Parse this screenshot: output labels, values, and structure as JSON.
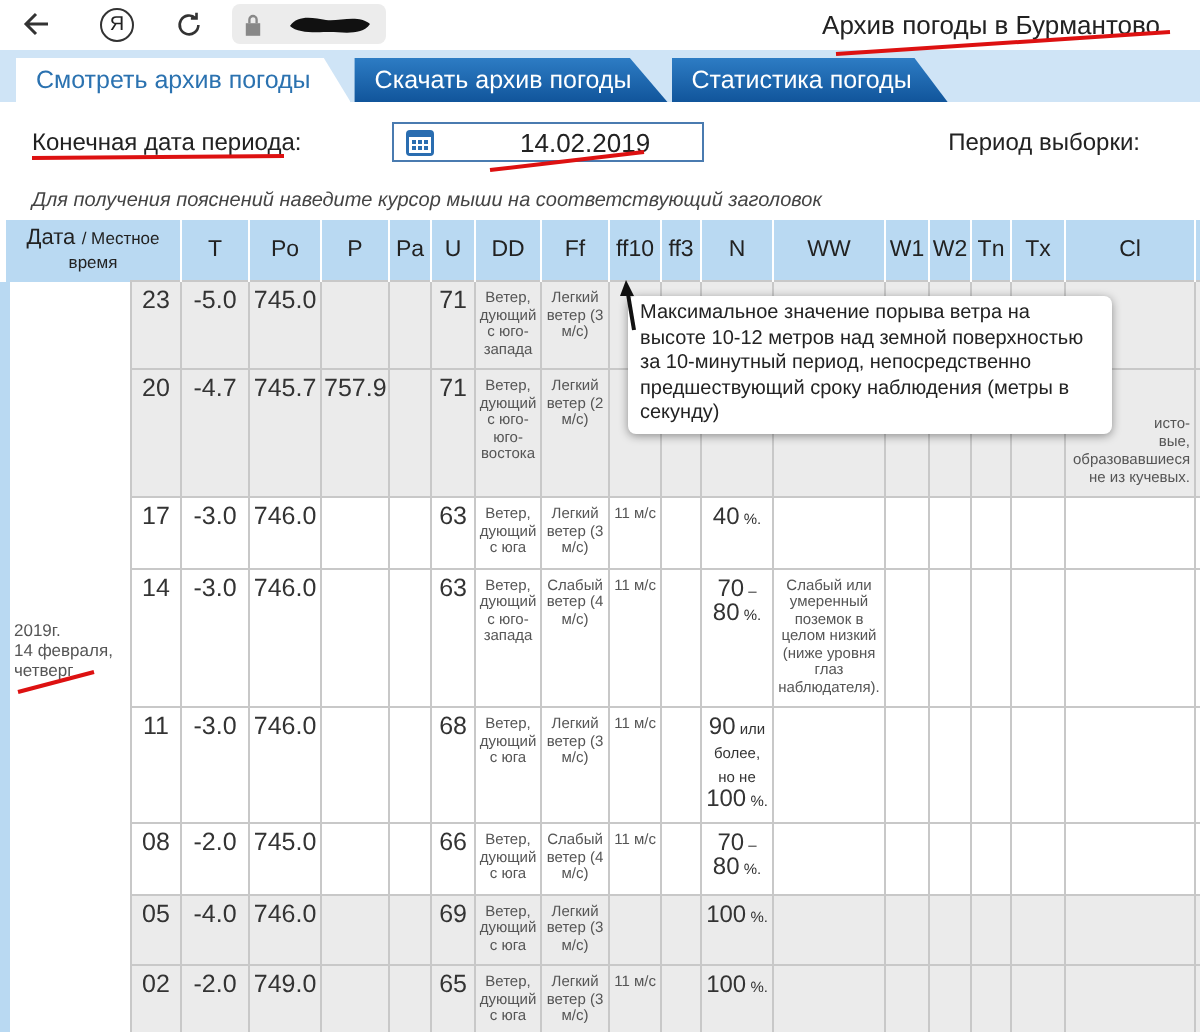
{
  "browser": {
    "yandex_button": "Я",
    "page_title": "Архив погоды в Бурмантово"
  },
  "tabs": [
    {
      "label": "Смотреть архив погоды",
      "selected": true
    },
    {
      "label": "Скачать архив погоды",
      "selected": false
    },
    {
      "label": "Статистика погоды",
      "selected": false
    }
  ],
  "controls": {
    "end_date_label": "Конечная дата периода:",
    "end_date": "14.02.2019",
    "period_label": "Период выборки:"
  },
  "hint": "Для получения пояснений наведите курсор мыши на соответствующий заголовок",
  "table": {
    "date_header": "Дата",
    "time_header": "/ Местное время",
    "columns": [
      "T",
      "Po",
      "P",
      "Pa",
      "U",
      "DD",
      "Ff",
      "ff10",
      "ff3",
      "N",
      "WW",
      "W1",
      "W2",
      "Tn",
      "Tx",
      "Cl"
    ],
    "date": "2019г.\n14 февраля,\nчетверг",
    "rows": [
      {
        "time": "23",
        "shaded": true,
        "cells": [
          "-5.0",
          "745.0",
          "",
          "",
          "71",
          "Ветер, дующий с юго-запада",
          "Легкий ветер (3 м/с)",
          "",
          "",
          "",
          "",
          "",
          "",
          "",
          "",
          ""
        ]
      },
      {
        "time": "20",
        "shaded": true,
        "cells": [
          "-4.7",
          "745.7",
          "757.9",
          "",
          "71",
          "Ветер, дующий с юго-юго-востока",
          "Легкий ветер (2 м/с)",
          "",
          "",
          "",
          "",
          "",
          "",
          "",
          "",
          "исто-\nвые,\nобразовавшиеся\nне из кучевых."
        ]
      },
      {
        "time": "17",
        "shaded": false,
        "cells": [
          "-3.0",
          "746.0",
          "",
          "",
          "63",
          "Ветер, дующий с юга",
          "Легкий ветер (3 м/с)",
          "11 м/с",
          "",
          "40 %.",
          "",
          "",
          "",
          "",
          "",
          ""
        ]
      },
      {
        "time": "14",
        "shaded": false,
        "cells": [
          "-3.0",
          "746.0",
          "",
          "",
          "63",
          "Ветер, дующий с юго-запада",
          "Слабый ветер (4 м/с)",
          "11 м/с",
          "",
          "70 – 80 %.",
          "Слабый или умеренный поземок в целом низкий (ниже уровня глаз наблюдателя).",
          "",
          "",
          "",
          "",
          ""
        ]
      },
      {
        "time": "11",
        "shaded": false,
        "cells": [
          "-3.0",
          "746.0",
          "",
          "",
          "68",
          "Ветер, дующий с юга",
          "Легкий ветер (3 м/с)",
          "11 м/с",
          "",
          "90 или более, но не 100 %.",
          "",
          "",
          "",
          "",
          "",
          ""
        ]
      },
      {
        "time": "08",
        "shaded": false,
        "cells": [
          "-2.0",
          "745.0",
          "",
          "",
          "66",
          "Ветер, дующий с юга",
          "Слабый ветер (4 м/с)",
          "11 м/с",
          "",
          "70 – 80 %.",
          "",
          "",
          "",
          "",
          "",
          ""
        ]
      },
      {
        "time": "05",
        "shaded": true,
        "cells": [
          "-4.0",
          "746.0",
          "",
          "",
          "69",
          "Ветер, дующий с юга",
          "Легкий ветер (3 м/с)",
          "",
          "",
          "100 %.",
          "",
          "",
          "",
          "",
          "",
          ""
        ]
      },
      {
        "time": "02",
        "shaded": true,
        "cells": [
          "-2.0",
          "749.0",
          "",
          "",
          "65",
          "Ветер, дующий с юга",
          "Легкий ветер (3 м/с)",
          "11 м/с",
          "",
          "100 %.",
          "",
          "",
          "",
          "",
          "",
          ""
        ]
      }
    ]
  },
  "tooltip": "Максимальное значение порыва ветра на высоте 10-12 метров над земной поверхностью за 10-минутный период, непосредственно предшествующий сроку наблюдения (метры в секунду)"
}
